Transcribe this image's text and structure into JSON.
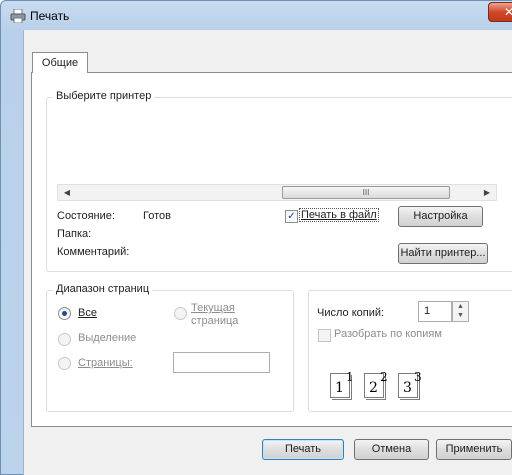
{
  "window": {
    "title": "Печать",
    "close_glyph": "✕"
  },
  "tabs": [
    {
      "label": "Общие"
    }
  ],
  "printer_group": {
    "legend": "Выберите принтер",
    "scroll_thumb_glyph": "III",
    "status_label": "Состояние:",
    "status_value": "Готов",
    "folder_label": "Папка:",
    "comment_label": "Комментарий:",
    "print_to_file_label": "Печать в файл",
    "print_to_file_checked": true,
    "settings_button": "Настройка",
    "find_printer_button": "Найти принтер..."
  },
  "range_group": {
    "legend": "Диапазон страниц",
    "all_label": "Все",
    "current_page_label_1": "Текущая",
    "current_page_label_2": "страница",
    "selection_label": "Выделение",
    "pages_label": "Страницы:",
    "pages_value": ""
  },
  "copies_group": {
    "copies_label": "Число копий:",
    "copies_value": "1",
    "collate_label": "Разобрать по копиям",
    "collate_pages": [
      {
        "num": "1",
        "sup": "1"
      },
      {
        "num": "2",
        "sup": "2"
      },
      {
        "num": "3",
        "sup": "3"
      }
    ]
  },
  "footer": {
    "print_button": "Печать",
    "cancel_button": "Отмена",
    "apply_button": "Применить"
  },
  "colors": {
    "accent": "#1f4d93",
    "frame": "#bcd3ec",
    "close": "#c0391b"
  }
}
